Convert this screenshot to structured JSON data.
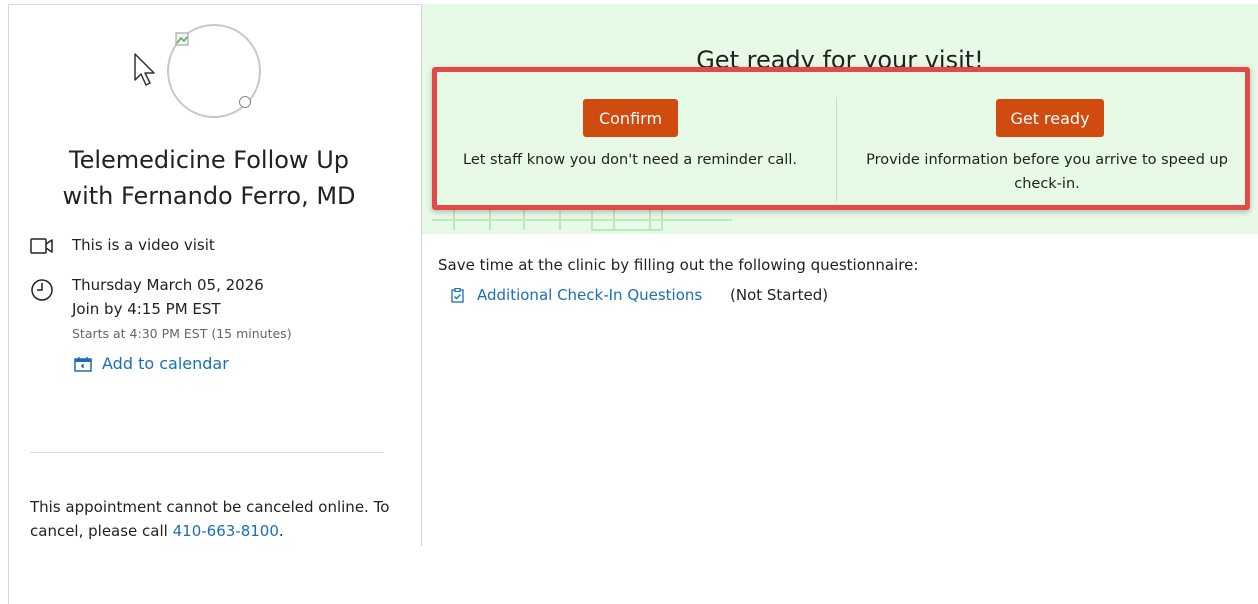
{
  "appointment": {
    "title_line1": "Telemedicine Follow Up",
    "title_line2": "with Fernando Ferro, MD",
    "video_label": "This is a video visit",
    "date": "Thursday March 05, 2026",
    "join_by": "Join by 4:15 PM EST",
    "starts_at": "Starts at 4:30 PM EST (15 minutes)",
    "add_to_calendar": "Add to calendar",
    "cancel_text": "This appointment cannot be canceled online. To cancel, please call",
    "cancel_phone": "410-663-8100",
    "cancel_period": "."
  },
  "banner": {
    "title": "Get ready for your visit!",
    "confirm_button": "Confirm",
    "confirm_desc": "Let staff know you don't need a reminder call.",
    "ready_button": "Get ready",
    "ready_desc": "Provide information before you arrive to speed up check-in."
  },
  "questionnaire": {
    "intro": "Save time at the clinic by filling out the following questionnaire:",
    "link": "Additional Check-In Questions",
    "status": "(Not Started)"
  },
  "colors": {
    "accent_button": "#d14a0f",
    "link": "#1a6fb5",
    "banner_bg": "#e6fae6",
    "highlight_border": "#e54848"
  },
  "icons": {
    "video": "video-camera-icon",
    "clock": "clock-icon",
    "calendar": "calendar-icon",
    "questionnaire": "clipboard-check-icon"
  }
}
